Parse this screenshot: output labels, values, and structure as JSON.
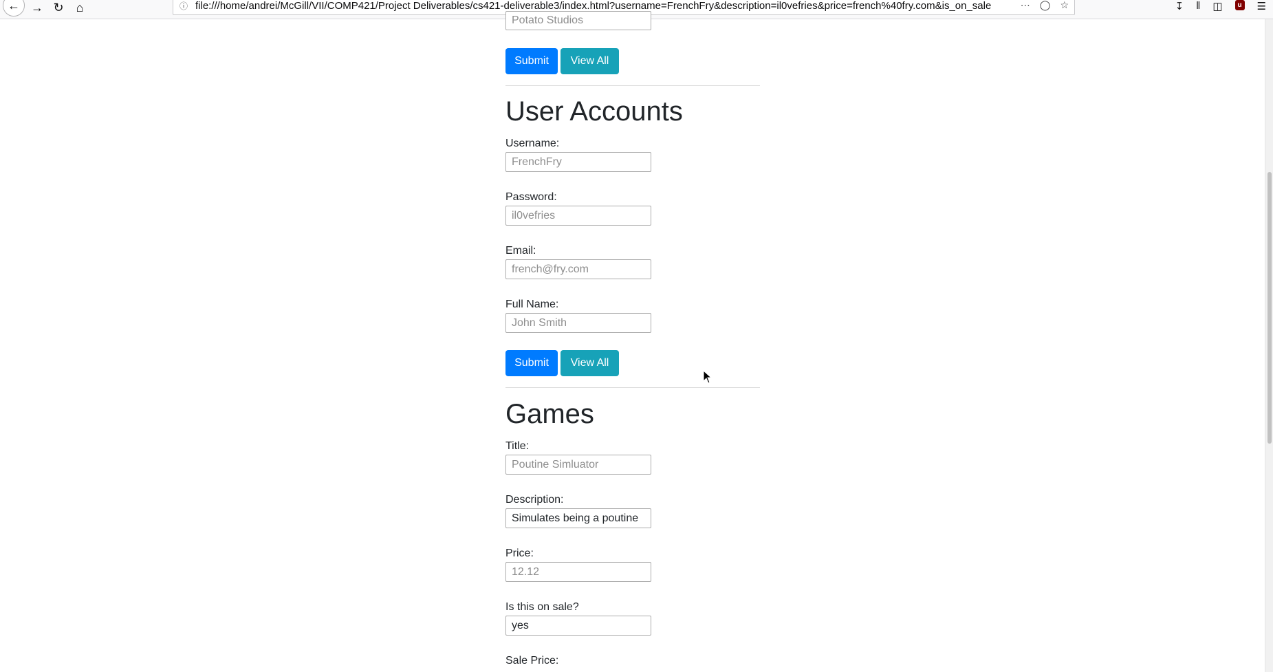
{
  "browser": {
    "url": "file:///home/andrei/McGill/VII/COMP421/Project Deliverables/cs421-deliverable3/index.html?username=FrenchFry&description=il0vefries&price=french%40fry.com&is_on_sale",
    "icons": {
      "back": "back-arrow-icon",
      "forward": "forward-arrow-icon",
      "reload": "reload-icon",
      "home": "home-icon",
      "info": "info-icon",
      "more": "more-icon",
      "pocket": "pocket-icon",
      "bookmark": "star-icon",
      "downloads": "download-icon",
      "library": "library-icon",
      "sidebar": "sidebar-icon",
      "ublock": "ublock-icon",
      "menu": "hamburger-menu-icon"
    }
  },
  "publishers": {
    "partial_input_placeholder": "Potato Studios",
    "submit_label": "Submit",
    "view_all_label": "View All"
  },
  "user_accounts": {
    "title": "User Accounts",
    "username": {
      "label": "Username:",
      "placeholder": "FrenchFry",
      "value": ""
    },
    "password": {
      "label": "Password:",
      "placeholder": "il0vefries",
      "value": ""
    },
    "email": {
      "label": "Email:",
      "placeholder": "french@fry.com",
      "value": ""
    },
    "full_name": {
      "label": "Full Name:",
      "placeholder": "John Smith",
      "value": ""
    },
    "submit_label": "Submit",
    "view_all_label": "View All"
  },
  "games": {
    "title": "Games",
    "game_title": {
      "label": "Title:",
      "placeholder": "Poutine Simluator",
      "value": ""
    },
    "description": {
      "label": "Description:",
      "placeholder": "",
      "value": "Simulates being a poutine"
    },
    "price": {
      "label": "Price:",
      "placeholder": "12.12",
      "value": ""
    },
    "on_sale": {
      "label": "Is this on sale?",
      "placeholder": "",
      "value": "yes"
    },
    "sale_price": {
      "label": "Sale Price:"
    }
  },
  "colors": {
    "primary": "#007bff",
    "info": "#17a2b8",
    "text": "#212529"
  }
}
